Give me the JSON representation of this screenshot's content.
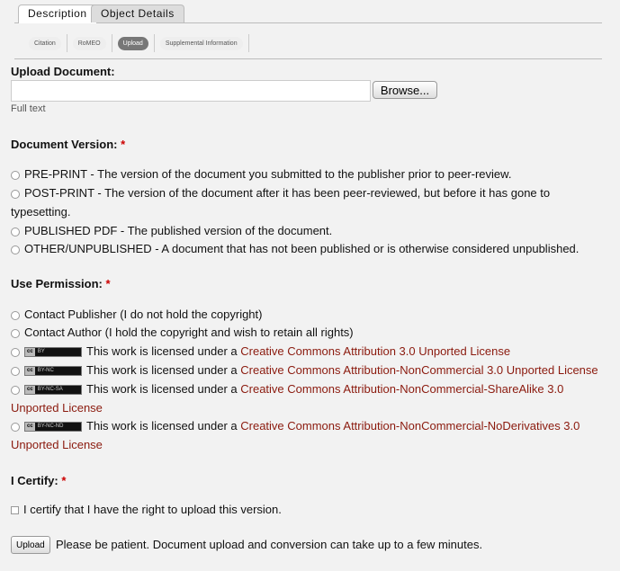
{
  "tabs": [
    "Description",
    "Object Details"
  ],
  "subnav": [
    "Citation",
    "RoMEO",
    "Upload",
    "Supplemental Information"
  ],
  "upload": {
    "heading": "Upload Document:",
    "browse": "Browse...",
    "hint": "Full text"
  },
  "version": {
    "heading": "Document Version:",
    "req": "*",
    "options": [
      "PRE-PRINT - The version of the document you submitted to the publisher prior to peer-review.",
      "POST-PRINT - The version of the document after it has been peer-reviewed, but before it has gone to typesetting.",
      "PUBLISHED PDF - The published version of the document.",
      "OTHER/UNPUBLISHED - A document that has not been published or is otherwise considered unpublished."
    ]
  },
  "permission": {
    "heading": "Use Permission:",
    "req": "*",
    "options": [
      "Contact Publisher (I do not hold the copyright)",
      "Contact Author (I hold the copyright and wish to retain all rights)"
    ],
    "prefix": "This work is licensed under a ",
    "licenses": [
      {
        "badge": "BY",
        "link": "Creative Commons Attribution 3.0 Unported License"
      },
      {
        "badge": "BY-NC",
        "link": "Creative Commons Attribution-NonCommercial 3.0 Unported License"
      },
      {
        "badge": "BY-NC-SA",
        "link": "Creative Commons Attribution-NonCommercial-ShareAlike 3.0 Unported License"
      },
      {
        "badge": "BY-NC-ND",
        "link": "Creative Commons Attribution-NonCommercial-NoDerivatives 3.0 Unported License"
      }
    ]
  },
  "certify": {
    "heading": "I Certify:",
    "req": "*",
    "label": "I certify that I have the right to upload this version."
  },
  "submit": {
    "label": "Upload",
    "note": "Please be patient. Document upload and conversion can take up to a few minutes."
  },
  "cc_label": "cc"
}
